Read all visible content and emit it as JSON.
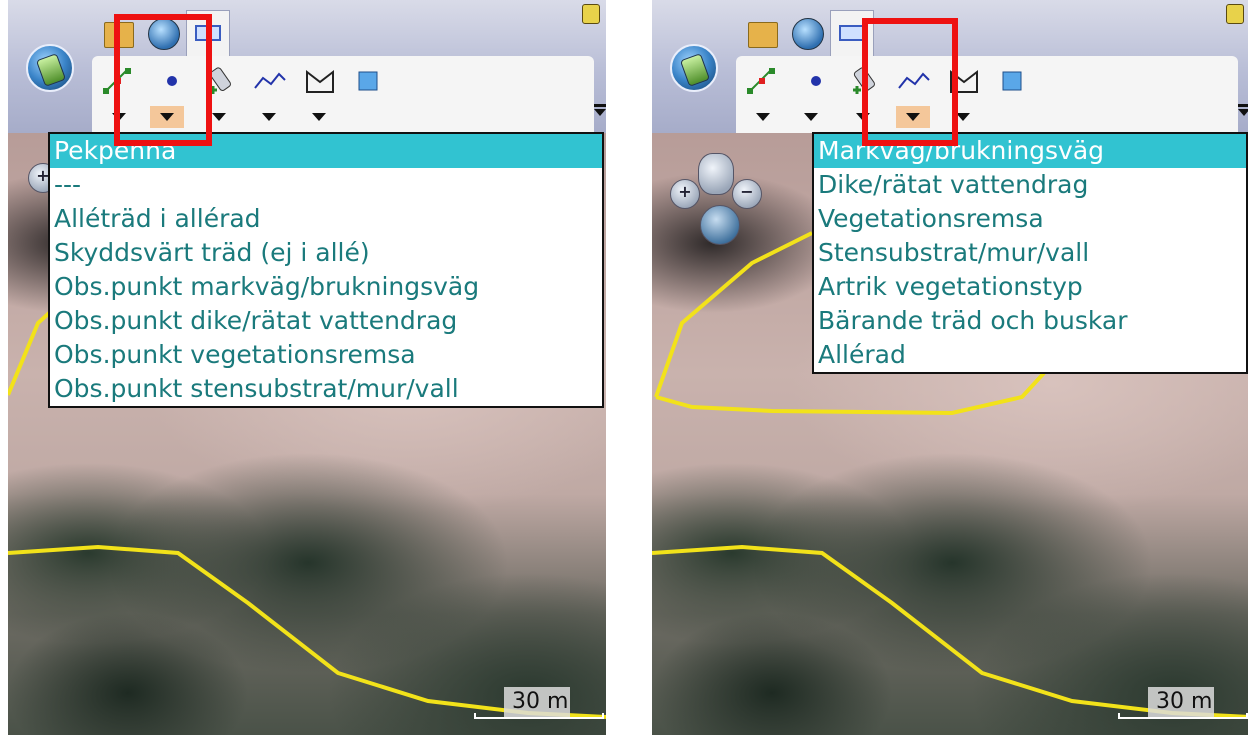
{
  "panels": [
    {
      "id": "left",
      "menu": {
        "items": [
          "Pekpenna",
          "---",
          "Alléträd i allérad",
          "Skyddsvärt träd (ej i allé)",
          "Obs.punkt markväg/brukningsväg",
          "Obs.punkt dike/rätat vattendrag",
          "Obs.punkt vegetationsremsa",
          "Obs.punkt stensubstrat/mur/vall"
        ],
        "highlighted_index": 0
      },
      "selected_dropdown": "point-tool",
      "scale_label": "30 m"
    },
    {
      "id": "right",
      "menu": {
        "items": [
          "Markväg/brukningsväg",
          "Dike/rätat vattendrag",
          "Vegetationsremsa",
          "Stensubstrat/mur/vall",
          "Artrik vegetationstyp",
          "Bärande träd och buskar",
          "Allérad"
        ],
        "highlighted_index": 0
      },
      "selected_dropdown": "line-tool",
      "scale_label": "30 m"
    }
  ],
  "colors": {
    "menu_text": "#1a7a7c",
    "menu_highlight": "#31c3d1",
    "annotation_box": "#ee1111",
    "road_line": "#f2e21a"
  },
  "icons": [
    "app-menu-icon",
    "folder-icon",
    "globe-icon",
    "window-icon",
    "lock-icon",
    "edit-vertex-icon",
    "point-icon",
    "gps-add-icon",
    "line-icon",
    "polygon-icon",
    "layer-icon",
    "zoom-in-icon",
    "pan-hand-icon",
    "zoom-out-icon",
    "globe-view-icon"
  ]
}
